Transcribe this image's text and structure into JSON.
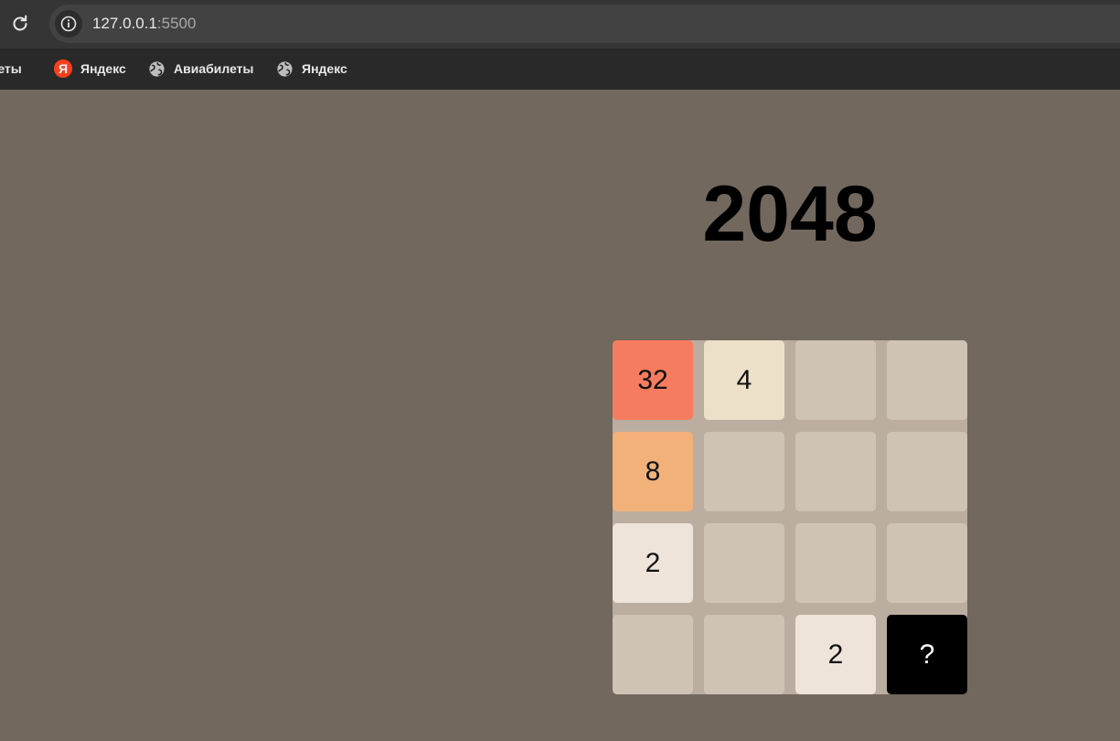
{
  "browser": {
    "url_host": "127.0.0.1",
    "url_port": ":5500",
    "bookmarks": [
      {
        "label": "илеты",
        "icon": "none"
      },
      {
        "label": "Яндекс",
        "icon": "yandex-icon"
      },
      {
        "label": "Авиабилеты",
        "icon": "globe-icon"
      },
      {
        "label": "Яндекс",
        "icon": "globe-icon"
      }
    ]
  },
  "game": {
    "title": "2048",
    "board": [
      [
        32,
        4,
        null,
        null
      ],
      [
        8,
        null,
        null,
        null
      ],
      [
        2,
        null,
        null,
        null
      ],
      [
        null,
        null,
        2,
        "?"
      ]
    ],
    "tiles": [
      {
        "label": "32",
        "color": "#f67c5f"
      },
      {
        "label": "4",
        "color": "#ede0c8"
      },
      {
        "label": "",
        "color": "#cfc3b6"
      },
      {
        "label": "",
        "color": "#cfc3b6"
      },
      {
        "label": "8",
        "color": "#f2b179"
      },
      {
        "label": "",
        "color": "#cfc3b6"
      },
      {
        "label": "",
        "color": "#cfc3b6"
      },
      {
        "label": "",
        "color": "#cfc3b6"
      },
      {
        "label": "2",
        "color": "#eee4da"
      },
      {
        "label": "",
        "color": "#cfc3b6"
      },
      {
        "label": "",
        "color": "#cfc3b6"
      },
      {
        "label": "",
        "color": "#cfc3b6"
      },
      {
        "label": "",
        "color": "#cfc3b6"
      },
      {
        "label": "",
        "color": "#cfc3b6"
      },
      {
        "label": "2",
        "color": "#eee4da"
      },
      {
        "label": "?",
        "color": "#000000"
      }
    ]
  },
  "colors": {
    "page_background": "#72685e",
    "board": "#bbada0",
    "empty_cell": "#cfc3b6"
  }
}
